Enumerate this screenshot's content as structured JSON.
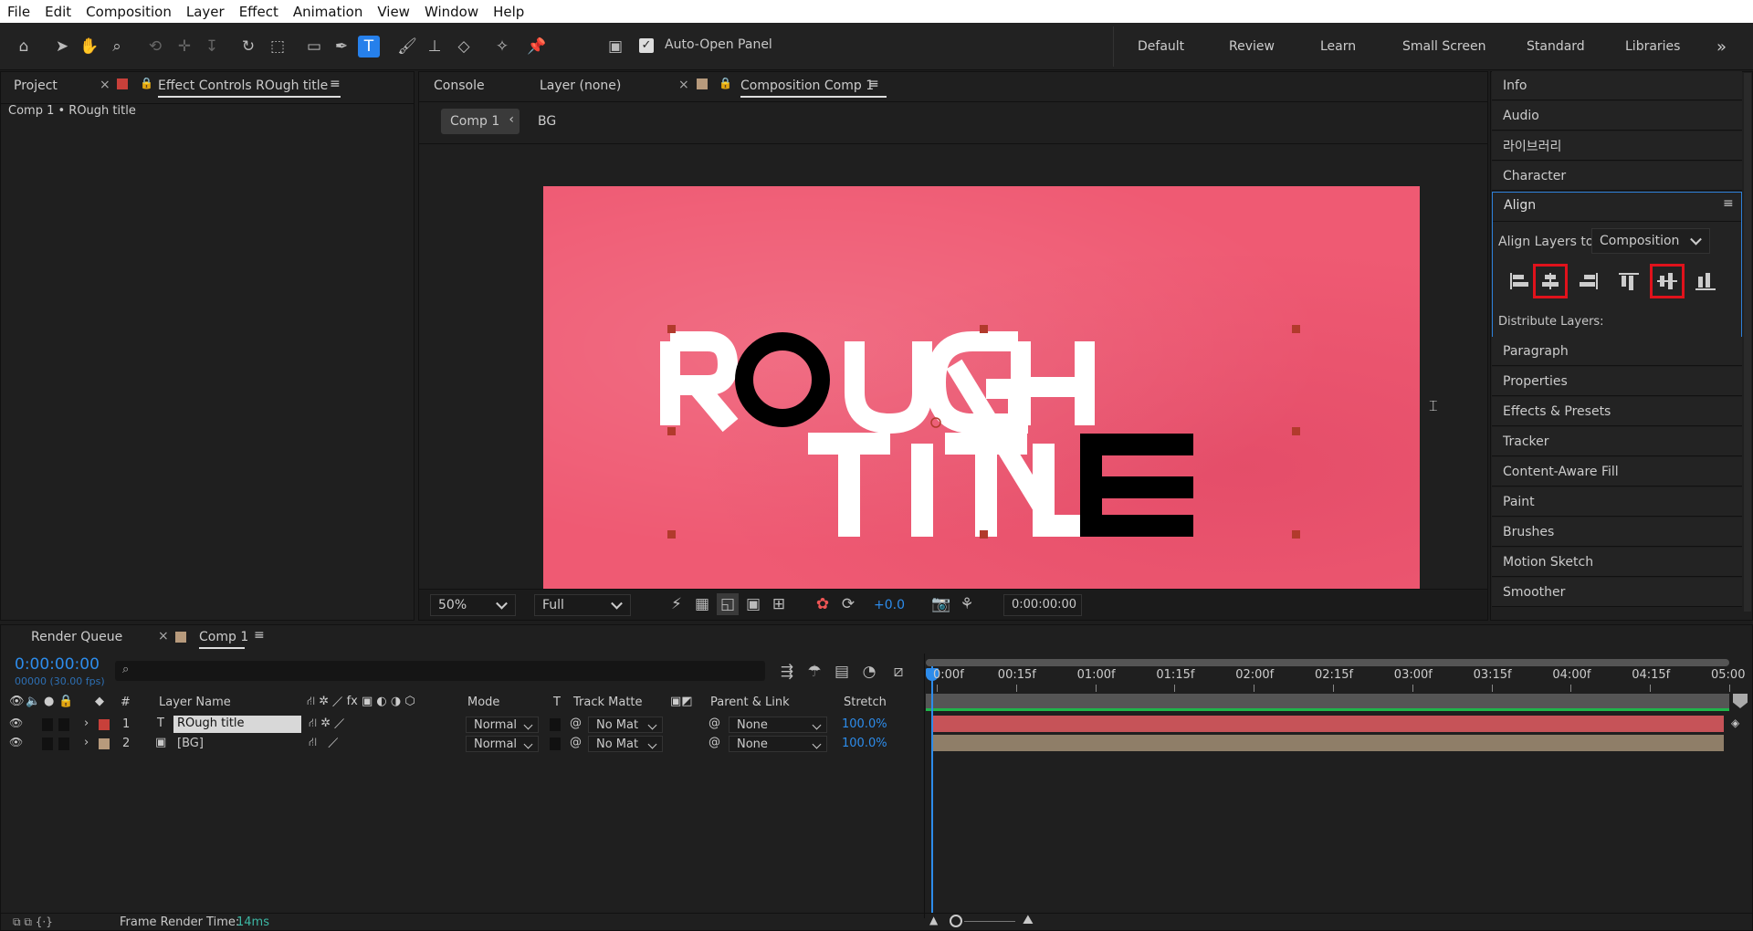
{
  "menu": [
    "File",
    "Edit",
    "Composition",
    "Layer",
    "Effect",
    "Animation",
    "View",
    "Window",
    "Help"
  ],
  "toolbar": {
    "auto_open_label": "Auto-Open Panel",
    "auto_open_checked": true
  },
  "workspaces": [
    "Default",
    "Review",
    "Learn",
    "Small Screen",
    "Standard",
    "Libraries"
  ],
  "left_panel": {
    "tab_project": "Project",
    "tab_effect": "Effect Controls ROugh    title",
    "breadcrumb": "Comp 1 • ROugh    title"
  },
  "viewer": {
    "tabs": [
      "Console",
      "Layer (none)",
      "Composition Comp 1"
    ],
    "crumbs": [
      "Comp 1",
      "BG"
    ],
    "zoom": "50%",
    "resolution": "Full",
    "exposure": "+0.0",
    "timecode": "0:00:00:00",
    "title_line1": "ROUGH",
    "title_line2": "TITLE",
    "bg_color": "#ef5a73"
  },
  "right_panel": {
    "items_top": [
      "Info",
      "Audio",
      "라이브러리",
      "Character"
    ],
    "align": {
      "title": "Align",
      "align_to_label": "Align Layers to:",
      "align_to_value": "Composition",
      "distribute_label": "Distribute Layers:"
    },
    "items_bottom": [
      "Paragraph",
      "Properties",
      "Effects & Presets",
      "Tracker",
      "Content-Aware Fill",
      "Paint",
      "Brushes",
      "Motion Sketch",
      "Smoother"
    ]
  },
  "timeline": {
    "tab_render": "Render Queue",
    "tab_comp": "Comp 1",
    "timecode": "0:00:00:00",
    "frames": "00000 (30.00 fps)",
    "columns": {
      "num": "#",
      "name": "Layer Name",
      "mode": "Mode",
      "t": "T",
      "track": "Track Matte",
      "parent": "Parent & Link",
      "stretch": "Stretch"
    },
    "layers": [
      {
        "num": "1",
        "name": "ROugh    title",
        "mode": "Normal",
        "track": "No Mat",
        "parent": "None",
        "stretch": "100.0%",
        "color": "#c8403a",
        "bar": "#c65358"
      },
      {
        "num": "2",
        "name": "[BG]",
        "mode": "Normal",
        "track": "No Mat",
        "parent": "None",
        "stretch": "100.0%",
        "color": "#b79a7c",
        "bar": "#8f7e68"
      }
    ],
    "ruler": [
      "0:00f",
      "00:15f",
      "01:00f",
      "01:15f",
      "02:00f",
      "02:15f",
      "03:00f",
      "03:15f",
      "04:00f",
      "04:15f",
      "05:00"
    ],
    "status_label": "Frame Render Time:",
    "status_value": "14ms"
  }
}
